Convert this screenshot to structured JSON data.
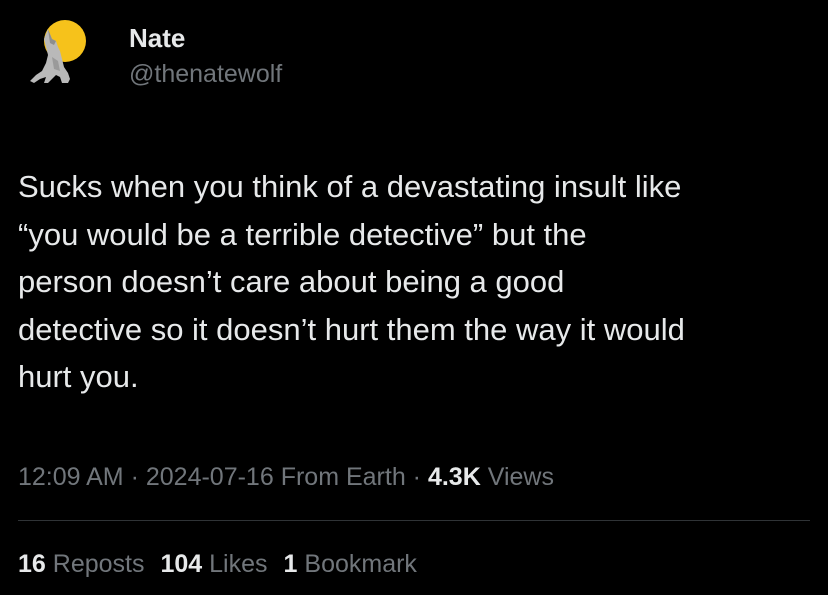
{
  "author": {
    "display_name": "Nate",
    "handle": "@thenatewolf",
    "avatar_icon": "howling-wolf-moon-icon"
  },
  "tweet": {
    "text": "Sucks when you think of a devastating insult like\n“you would be a terrible detective” but the\nperson doesn’t care about being a good\ndetective so it doesn’t hurt them the way it would\nhurt you."
  },
  "meta": {
    "time": "12:09 AM",
    "separator": " · ",
    "date": "2024-07-16",
    "source": "From Earth",
    "views_count": "4.3K",
    "views_label": "Views"
  },
  "stats": {
    "reposts_count": "16",
    "reposts_label": "Reposts",
    "likes_count": "104",
    "likes_label": "Likes",
    "bookmarks_count": "1",
    "bookmarks_label": "Bookmark"
  },
  "colors": {
    "background": "#000000",
    "primary_text": "#e7e9ea",
    "secondary_text": "#71767b",
    "divider": "#2f3336",
    "moon": "#f6c21b"
  }
}
